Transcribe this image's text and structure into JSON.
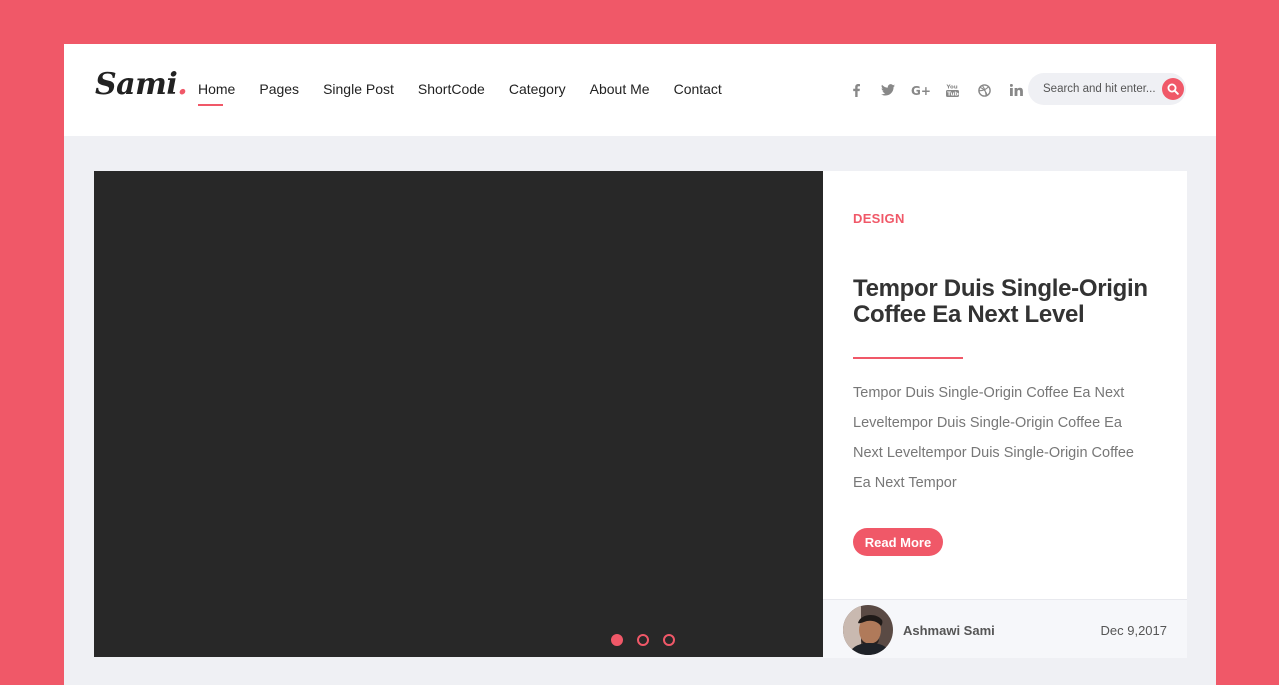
{
  "brand": {
    "name": "Sami",
    "dot": "."
  },
  "nav": {
    "items": [
      {
        "label": "Home",
        "active": true
      },
      {
        "label": "Pages"
      },
      {
        "label": "Single Post"
      },
      {
        "label": "ShortCode"
      },
      {
        "label": "Category"
      },
      {
        "label": "About Me"
      },
      {
        "label": "Contact"
      }
    ]
  },
  "social": [
    "facebook-icon",
    "twitter-icon",
    "google-plus-icon",
    "youtube-icon",
    "dribbble-icon",
    "linkedin-icon"
  ],
  "search": {
    "placeholder": "Search and hit enter..."
  },
  "slider": {
    "slide_count": 3,
    "active_slide": 1
  },
  "post": {
    "category": "DESIGN",
    "title": "Tempor Duis Single-Origin Coffee Ea Next Level",
    "excerpt": "Tempor Duis Single-Origin Coffee Ea Next Leveltempor Duis Single-Origin Coffee Ea Next Leveltempor Duis Single-Origin Coffee Ea Next Tempor",
    "read_more": "Read More",
    "author": "Ashmawi Sami",
    "date": "Dec 9,2017"
  },
  "colors": {
    "accent": "#f05868",
    "slide_bg": "#282828",
    "page_bg": "#eff0f4"
  }
}
